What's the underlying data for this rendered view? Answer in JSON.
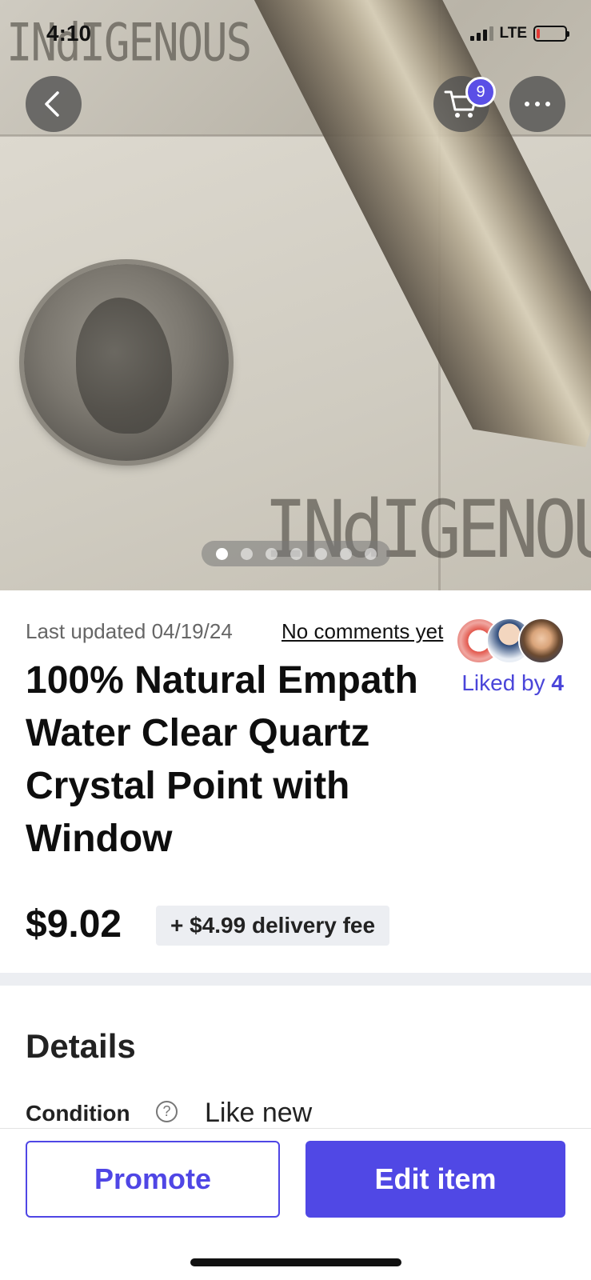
{
  "status_bar": {
    "time": "4:10",
    "network": "LTE",
    "signal_bars": 3,
    "signal_bars_total": 4,
    "battery_level": 0.12,
    "battery_color": "#e53935"
  },
  "hero": {
    "photo_count": 7,
    "active_photo_index": 0,
    "watermark_text": "INdIGENOUS"
  },
  "toolbar": {
    "back_icon": "chevron-left-icon",
    "cart_icon": "shopping-cart-icon",
    "cart_count": "9",
    "more_icon": "more-horizontal-icon"
  },
  "item": {
    "last_updated": "Last updated 04/19/24",
    "comments_link": "No comments yet",
    "liked_by_label": "Liked by",
    "liked_by_count": "4",
    "title": "100% Natural Empath Water Clear Quartz Crystal Point with Window",
    "price": "$9.02",
    "delivery_fee": "+ $4.99 delivery fee"
  },
  "details": {
    "heading": "Details",
    "condition_label": "Condition",
    "condition_help_icon": "question-circle-icon",
    "condition_value": "Like new"
  },
  "actions": {
    "promote_label": "Promote",
    "edit_label": "Edit item"
  },
  "colors": {
    "accent": "#5048e5",
    "liked_text": "#4a45d9",
    "badge": "#5a4fe6",
    "divider": "#eceef2"
  }
}
